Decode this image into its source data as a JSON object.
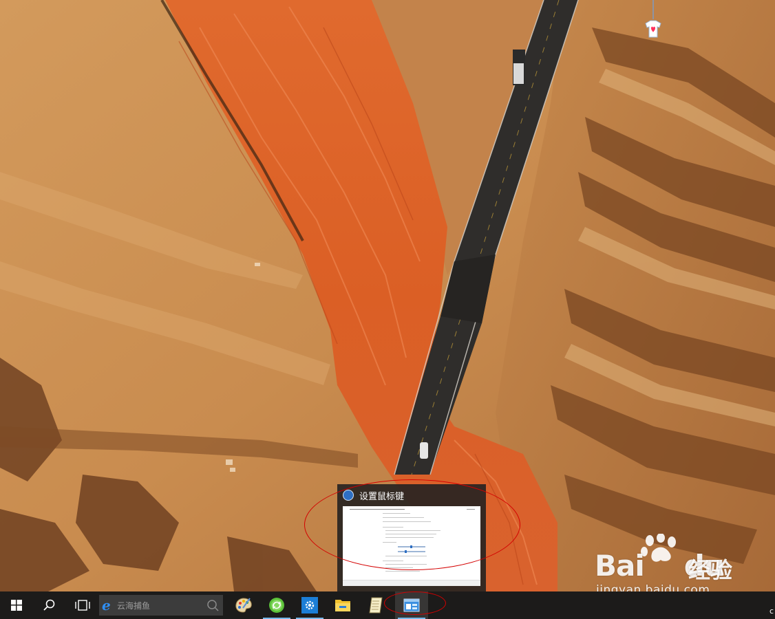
{
  "desktop": {
    "wallpaper_icon": "aerial-desert-wallpaper",
    "shirt_icon": "shirt-icon"
  },
  "thumbnail_preview": {
    "title": "设置鼠标键",
    "app_icon": "ease-of-access-icon"
  },
  "taskbar": {
    "start_icon": "windows-start-icon",
    "search_icon": "search-icon",
    "task_view_icon": "task-view-icon",
    "search_placeholder": "云海捕鱼",
    "search_browser_icon": "edge-e-icon",
    "pinned": [
      {
        "name": "paint-icon"
      },
      {
        "name": "refresh-circle-icon"
      },
      {
        "name": "settings-gear-icon"
      },
      {
        "name": "file-explorer-icon"
      },
      {
        "name": "notepad-icon"
      },
      {
        "name": "control-panel-window-icon"
      }
    ],
    "clock_fragment": "c"
  },
  "watermark": {
    "logo": "Bai",
    "logo_tail": "du",
    "brand": "经验",
    "url": "jingyan.baidu.com"
  },
  "colors": {
    "taskbar_bg": "#1c1b1a",
    "accent": "#76b9ed",
    "annotation": "#d40000"
  }
}
